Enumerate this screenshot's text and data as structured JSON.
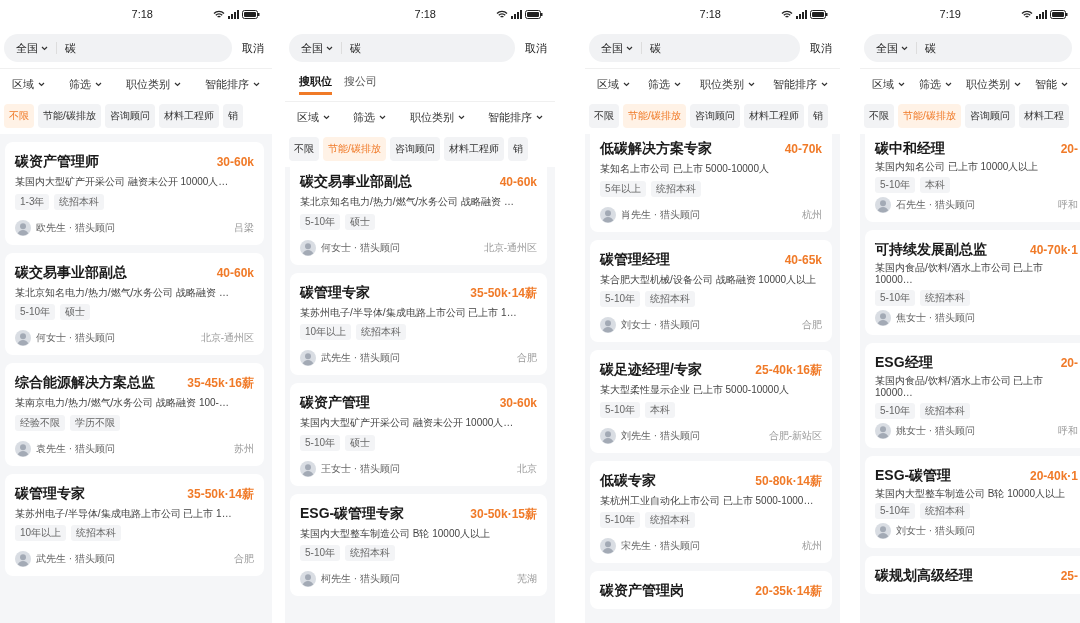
{
  "phones": [
    {
      "time": "7:18",
      "search": {
        "region": "全国",
        "query": "碳",
        "cancel": "取消"
      },
      "filters": [
        "区域",
        "筛选",
        "职位类别",
        "智能排序"
      ],
      "chips": [
        {
          "label": "不限",
          "selected": true
        },
        {
          "label": "节能/碳排放",
          "selected": false
        },
        {
          "label": "咨询顾问",
          "selected": false
        },
        {
          "label": "材料工程师",
          "selected": false
        },
        {
          "label": "销",
          "selected": false
        }
      ],
      "scrolled": false,
      "jobs": [
        {
          "title": "碳资产管理师",
          "salary": "30-60k",
          "company": "某国内大型矿产开采公司  融资未公开  10000人…",
          "tags": [
            "1-3年",
            "统招本科"
          ],
          "recruiter": "欧先生 · 猎头顾问",
          "location": "吕梁"
        },
        {
          "title": "碳交易事业部副总",
          "salary": "40-60k",
          "company": "某北京知名电力/热力/燃气/水务公司  战略融资  …",
          "tags": [
            "5-10年",
            "硕士"
          ],
          "recruiter": "何女士 · 猎头顾问",
          "location": "北京-通州区"
        },
        {
          "title": "综合能源解决方案总监",
          "salary": "35-45k·16薪",
          "company": "某南京电力/热力/燃气/水务公司  战略融资  100-…",
          "tags": [
            "经验不限",
            "学历不限"
          ],
          "recruiter": "袁先生 · 猎头顾问",
          "location": "苏州"
        },
        {
          "title": "碳管理专家",
          "salary": "35-50k·14薪",
          "company": "某苏州电子/半导体/集成电路上市公司  已上市  1…",
          "tags": [
            "10年以上",
            "统招本科"
          ],
          "recruiter": "武先生 · 猎头顾问",
          "location": "合肥"
        }
      ]
    },
    {
      "time": "7:18",
      "search": {
        "region": "全国",
        "query": "碳",
        "cancel": "取消"
      },
      "tabs": [
        {
          "label": "搜职位",
          "selected": true
        },
        {
          "label": "搜公司",
          "selected": false
        }
      ],
      "filters": [
        "区域",
        "筛选",
        "职位类别",
        "智能排序"
      ],
      "chips": [
        {
          "label": "不限",
          "selected": false
        },
        {
          "label": "节能/碳排放",
          "selected": true
        },
        {
          "label": "咨询顾问",
          "selected": false
        },
        {
          "label": "材料工程师",
          "selected": false
        },
        {
          "label": "销",
          "selected": false
        }
      ],
      "scrolled": true,
      "jobs": [
        {
          "title": "碳交易事业部副总",
          "salary": "40-60k",
          "company": "某北京知名电力/热力/燃气/水务公司  战略融资  …",
          "tags": [
            "5-10年",
            "硕士"
          ],
          "recruiter": "何女士 · 猎头顾问",
          "location": "北京-通州区"
        },
        {
          "title": "碳管理专家",
          "salary": "35-50k·14薪",
          "company": "某苏州电子/半导体/集成电路上市公司  已上市  1…",
          "tags": [
            "10年以上",
            "统招本科"
          ],
          "recruiter": "武先生 · 猎头顾问",
          "location": "合肥"
        },
        {
          "title": "碳资产管理",
          "salary": "30-60k",
          "company": "某国内大型矿产开采公司  融资未公开  10000人…",
          "tags": [
            "5-10年",
            "硕士"
          ],
          "recruiter": "王女士 · 猎头顾问",
          "location": "北京"
        },
        {
          "title": "ESG-碳管理专家",
          "salary": "30-50k·15薪",
          "company": "某国内大型整车制造公司  B轮  10000人以上",
          "tags": [
            "5-10年",
            "统招本科"
          ],
          "recruiter": "柯先生 · 猎头顾问",
          "location": "芜湖"
        }
      ]
    },
    {
      "time": "7:18",
      "search": {
        "region": "全国",
        "query": "碳",
        "cancel": "取消"
      },
      "filters": [
        "区域",
        "筛选",
        "职位类别",
        "智能排序"
      ],
      "chips": [
        {
          "label": "不限",
          "selected": false
        },
        {
          "label": "节能/碳排放",
          "selected": true
        },
        {
          "label": "咨询顾问",
          "selected": false
        },
        {
          "label": "材料工程师",
          "selected": false
        },
        {
          "label": "销",
          "selected": false
        }
      ],
      "scrolled": true,
      "jobs": [
        {
          "title": "低碳解决方案专家",
          "salary": "40-70k",
          "company": "某知名上市公司  已上市  5000-10000人",
          "tags": [
            "5年以上",
            "统招本科"
          ],
          "recruiter": "肖先生 · 猎头顾问",
          "location": "杭州"
        },
        {
          "title": "碳管理经理",
          "salary": "40-65k",
          "company": "某合肥大型机械/设备公司  战略融资  10000人以上",
          "tags": [
            "5-10年",
            "统招本科"
          ],
          "recruiter": "刘女士 · 猎头顾问",
          "location": "合肥"
        },
        {
          "title": "碳足迹经理/专家",
          "salary": "25-40k·16薪",
          "company": "某大型柔性显示企业  已上市  5000-10000人",
          "tags": [
            "5-10年",
            "本科"
          ],
          "recruiter": "刘先生 · 猎头顾问",
          "location": "合肥-新站区"
        },
        {
          "title": "低碳专家",
          "salary": "50-80k·14薪",
          "company": "某杭州工业自动化上市公司  已上市  5000-1000…",
          "tags": [
            "5-10年",
            "统招本科"
          ],
          "recruiter": "宋先生 · 猎头顾问",
          "location": "杭州"
        },
        {
          "title": "碳资产管理岗",
          "salary": "20-35k·14薪"
        }
      ]
    },
    {
      "time": "7:19",
      "search": {
        "region": "全国",
        "query": "碳"
      },
      "filters": [
        "区域",
        "筛选",
        "职位类别",
        "智能"
      ],
      "chips": [
        {
          "label": "不限",
          "selected": false
        },
        {
          "label": "节能/碳排放",
          "selected": true
        },
        {
          "label": "咨询顾问",
          "selected": false
        },
        {
          "label": "材料工程",
          "selected": false
        }
      ],
      "scrolled": true,
      "jobs": [
        {
          "title": "碳中和经理",
          "salary": "20-",
          "company": "某国内知名公司  已上市  10000人以上",
          "tags": [
            "5-10年",
            "本科"
          ],
          "recruiter": "石先生 · 猎头顾问",
          "location": "呼和"
        },
        {
          "title": "可持续发展副总监",
          "salary": "40-70k·1",
          "company": "某国内食品/饮料/酒水上市公司  已上市  10000…",
          "tags": [
            "5-10年",
            "统招本科"
          ],
          "recruiter": "焦女士 · 猎头顾问"
        },
        {
          "title": "ESG经理",
          "salary": "20-",
          "company": "某国内食品/饮料/酒水上市公司  已上市  10000…",
          "tags": [
            "5-10年",
            "统招本科"
          ],
          "recruiter": "姚女士 · 猎头顾问",
          "location": "呼和"
        },
        {
          "title": "ESG-碳管理",
          "salary": "20-40k·1",
          "company": "某国内大型整车制造公司  B轮  10000人以上",
          "tags": [
            "5-10年",
            "统招本科"
          ],
          "recruiter": "刘女士 · 猎头顾问"
        },
        {
          "title": "碳规划高级经理",
          "salary": "25-"
        }
      ]
    }
  ]
}
